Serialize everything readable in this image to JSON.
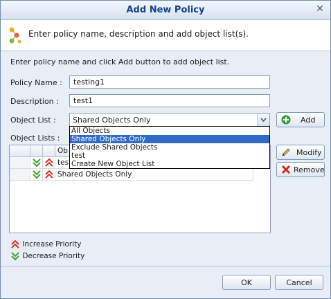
{
  "window": {
    "title": "Add New Policy"
  },
  "header": {
    "text": "Enter policy name, description and add object list(s)."
  },
  "instructions": "Enter policy name and click Add button to add object list.",
  "form": {
    "policy_name_label": "Policy Name :",
    "policy_name_value": "testing1",
    "description_label": "Description :",
    "description_value": "test1",
    "object_list_label": "Object List :",
    "object_list_value": "Shared Objects Only",
    "object_lists_label": "Object Lists :"
  },
  "dropdown": {
    "options": [
      "All Objects",
      "Shared Objects Only",
      "Exclude Shared Objects",
      "test",
      "Create New Object List"
    ],
    "selected_index": 1
  },
  "buttons": {
    "add": "Add",
    "modify": "Modify",
    "remove": "Remove",
    "ok": "OK",
    "cancel": "Cancel"
  },
  "grid": {
    "header_partial": "Ob",
    "rows": [
      {
        "name": "test"
      },
      {
        "name": "Shared Objects Only"
      }
    ]
  },
  "legend": {
    "increase": "Increase Priority",
    "decrease": "Decrease Priority"
  },
  "colors": {
    "increase_arrow": "#d9302a",
    "decrease_arrow": "#3fa32f",
    "add_icon": "#2f9e35",
    "remove_icon": "#d22a1f",
    "title": "#15428b",
    "selection": "#316ac5"
  }
}
